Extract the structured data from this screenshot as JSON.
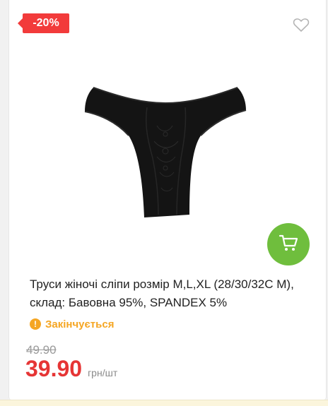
{
  "product": {
    "discount_badge": "-20%",
    "title": "Труси жіночі сліпи розмір M,L,XL (28/30/32C M), склад: Бавовна 95%, SPANDEX 5%",
    "stock_status": "Закінчується",
    "stock_icon_glyph": "!",
    "old_price": "49.90",
    "price": "39.90",
    "price_unit": "грн/шт"
  },
  "icons": {
    "favorite": "heart-icon",
    "cart": "cart-icon",
    "stock": "warning-icon"
  },
  "colors": {
    "badge": "#f23b3b",
    "price": "#e63535",
    "cart_button": "#6fbe3d",
    "stock_warning": "#f5a623"
  }
}
